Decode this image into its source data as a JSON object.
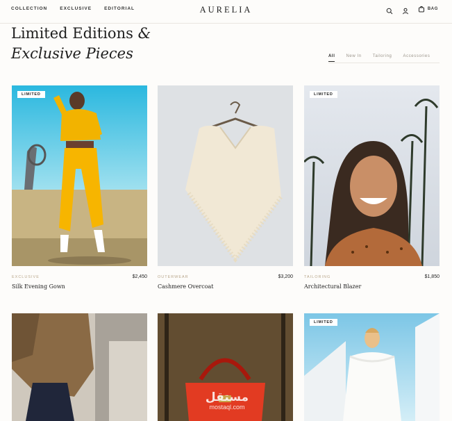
{
  "header": {
    "nav": [
      "COLLECTION",
      "EXCLUSIVE",
      "EDITORIAL"
    ],
    "brand": "AURELIA",
    "bag_label": "BAG"
  },
  "hero": {
    "line1": "Limited Editions",
    "amp": "&",
    "line2": "Exclusive Pieces"
  },
  "filters": [
    "All",
    "New In",
    "Tailoring",
    "Accessories"
  ],
  "products": [
    {
      "badge": "LIMITED",
      "category": "EXCLUSIVE",
      "name": "Silk Evening Gown",
      "price": "$2,450"
    },
    {
      "badge": "",
      "category": "OUTERWEAR",
      "name": "Cashmere Overcoat",
      "price": "$3,200"
    },
    {
      "badge": "LIMITED",
      "category": "TAILORING",
      "name": "Architectural Blazer",
      "price": "$1,850"
    },
    {
      "badge": ""
    },
    {
      "badge": ""
    },
    {
      "badge": "LIMITED"
    }
  ],
  "watermark": {
    "arabic": "مستقل",
    "latin": "mostaql.com"
  },
  "colors": {
    "accent_category": "#b8a68a",
    "background": "#fdfcfa"
  },
  "icons": [
    "search-icon",
    "user-icon",
    "bag-icon"
  ]
}
